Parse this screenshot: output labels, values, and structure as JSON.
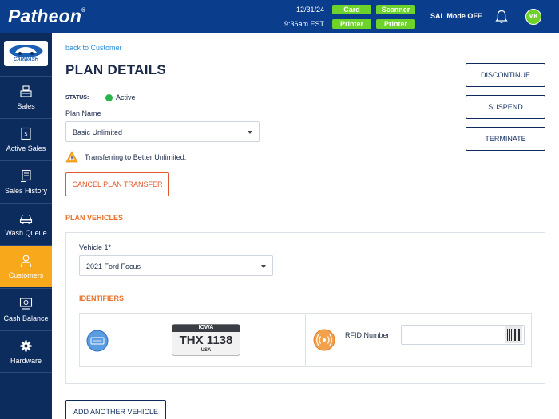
{
  "header": {
    "logo": "Patheon",
    "logo_mark": "®",
    "date": "12/31/24",
    "time": "9:36am EST",
    "devices": [
      {
        "label": "Card",
        "color": "#6dd22a"
      },
      {
        "label": "Scanner",
        "color": "#6dd22a"
      },
      {
        "label": "Printer",
        "color": "#6dd22a"
      },
      {
        "label": "Printer",
        "color": "#6dd22a"
      }
    ],
    "sal_mode": "SAL Mode OFF",
    "avatar_initials": "MK"
  },
  "sidebar": {
    "brand_text": "CARWASH",
    "items": [
      {
        "label": "Sales",
        "icon": "cash-register-icon"
      },
      {
        "label": "Active Sales",
        "icon": "receipt-icon"
      },
      {
        "label": "Sales History",
        "icon": "history-icon"
      },
      {
        "label": "Wash Queue",
        "icon": "car-icon"
      },
      {
        "label": "Customers",
        "icon": "user-icon"
      },
      {
        "label": "Cash Balance",
        "icon": "cash-balance-icon"
      },
      {
        "label": "Hardware",
        "icon": "gear-icon"
      }
    ],
    "active_item": "Customers"
  },
  "main": {
    "back_link": "back to Customer",
    "title": "PLAN DETAILS",
    "status_label": "STATUS:",
    "status_value": "Active",
    "status_color": "#28b34b",
    "plan_name_label": "Plan Name",
    "plan_name_value": "Basic Unlimited",
    "warning_text": "Transferring to Better Unlimited.",
    "cancel_transfer": "CANCEL PLAN TRANSFER",
    "actions": {
      "discontinue": "DISCONTINUE",
      "suspend": "SUSPEND",
      "terminate": "TERMINATE"
    },
    "plan_vehicles_title": "PLAN VEHICLES",
    "vehicle": {
      "label": "Vehicle 1*",
      "value": "2021 Ford Focus",
      "identifiers_title": "IDENTIFIERS",
      "plate": {
        "state": "IOWA",
        "number": "THX 1138",
        "country": "USA"
      },
      "rfid_label": "RFID Number",
      "rfid_value": ""
    },
    "add_vehicle": "ADD ANOTHER VEHICLE"
  },
  "colors": {
    "header_bg": "#0a3e8c",
    "sidebar_bg": "#0d2c5e",
    "active_nav": "#f8a81b",
    "accent_orange": "#e8722a",
    "link_blue": "#2f8fd6"
  }
}
